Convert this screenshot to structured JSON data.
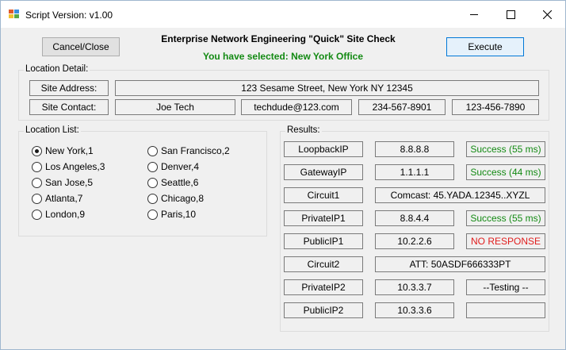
{
  "window": {
    "title": "Script Version:  v1.00",
    "controls": {
      "minimize": "minimize-icon",
      "maximize": "maximize-icon",
      "close": "close-icon"
    }
  },
  "header": {
    "cancel_label": "Cancel/Close",
    "title": "Enterprise Network Engineering \"Quick\" Site Check",
    "selected_text": "You have selected: New York Office",
    "execute_label": "Execute"
  },
  "location_detail": {
    "label": "Location Detail:",
    "site_address_label": "Site Address:",
    "site_address": "123 Sesame Street, New York NY 12345",
    "site_contact_label": "Site Contact:",
    "contact_name": "Joe Tech",
    "contact_email": "techdude@123.com",
    "contact_phone1": "234-567-8901",
    "contact_phone2": "123-456-7890"
  },
  "location_list": {
    "label": "Location List:",
    "selected": "New York,1",
    "items": [
      "New York,1",
      "San Francisco,2",
      "Los Angeles,3",
      "Denver,4",
      "San Jose,5",
      "Seattle,6",
      "Atlanta,7",
      "Chicago,8",
      "London,9",
      "Paris,10"
    ]
  },
  "results": {
    "label": "Results:",
    "rows": [
      {
        "name": "LoopbackIP",
        "value": "8.8.8.8",
        "status": "Success (55 ms)",
        "status_type": "ok"
      },
      {
        "name": "GatewayIP",
        "value": "1.1.1.1",
        "status": "Success (44 ms)",
        "status_type": "ok"
      },
      {
        "name": "Circuit1",
        "value": "Comcast: 45.YADA.12345..XYZL"
      },
      {
        "name": "PrivateIP1",
        "value": "8.8.4.4",
        "status": "Success (55 ms)",
        "status_type": "ok"
      },
      {
        "name": "PublicIP1",
        "value": "10.2.2.6",
        "status": "NO RESPONSE",
        "status_type": "bad"
      },
      {
        "name": "Circuit2",
        "value": "ATT: 50ASDF666333PT"
      },
      {
        "name": "PrivateIP2",
        "value": "10.3.3.7",
        "status": "--Testing --",
        "status_type": "neutral"
      },
      {
        "name": "PublicIP2",
        "value": "10.3.3.6",
        "status": "",
        "status_type": "neutral"
      }
    ]
  },
  "colors": {
    "success": "#138a13",
    "error": "#e11d1d",
    "accent": "#0078d7"
  }
}
